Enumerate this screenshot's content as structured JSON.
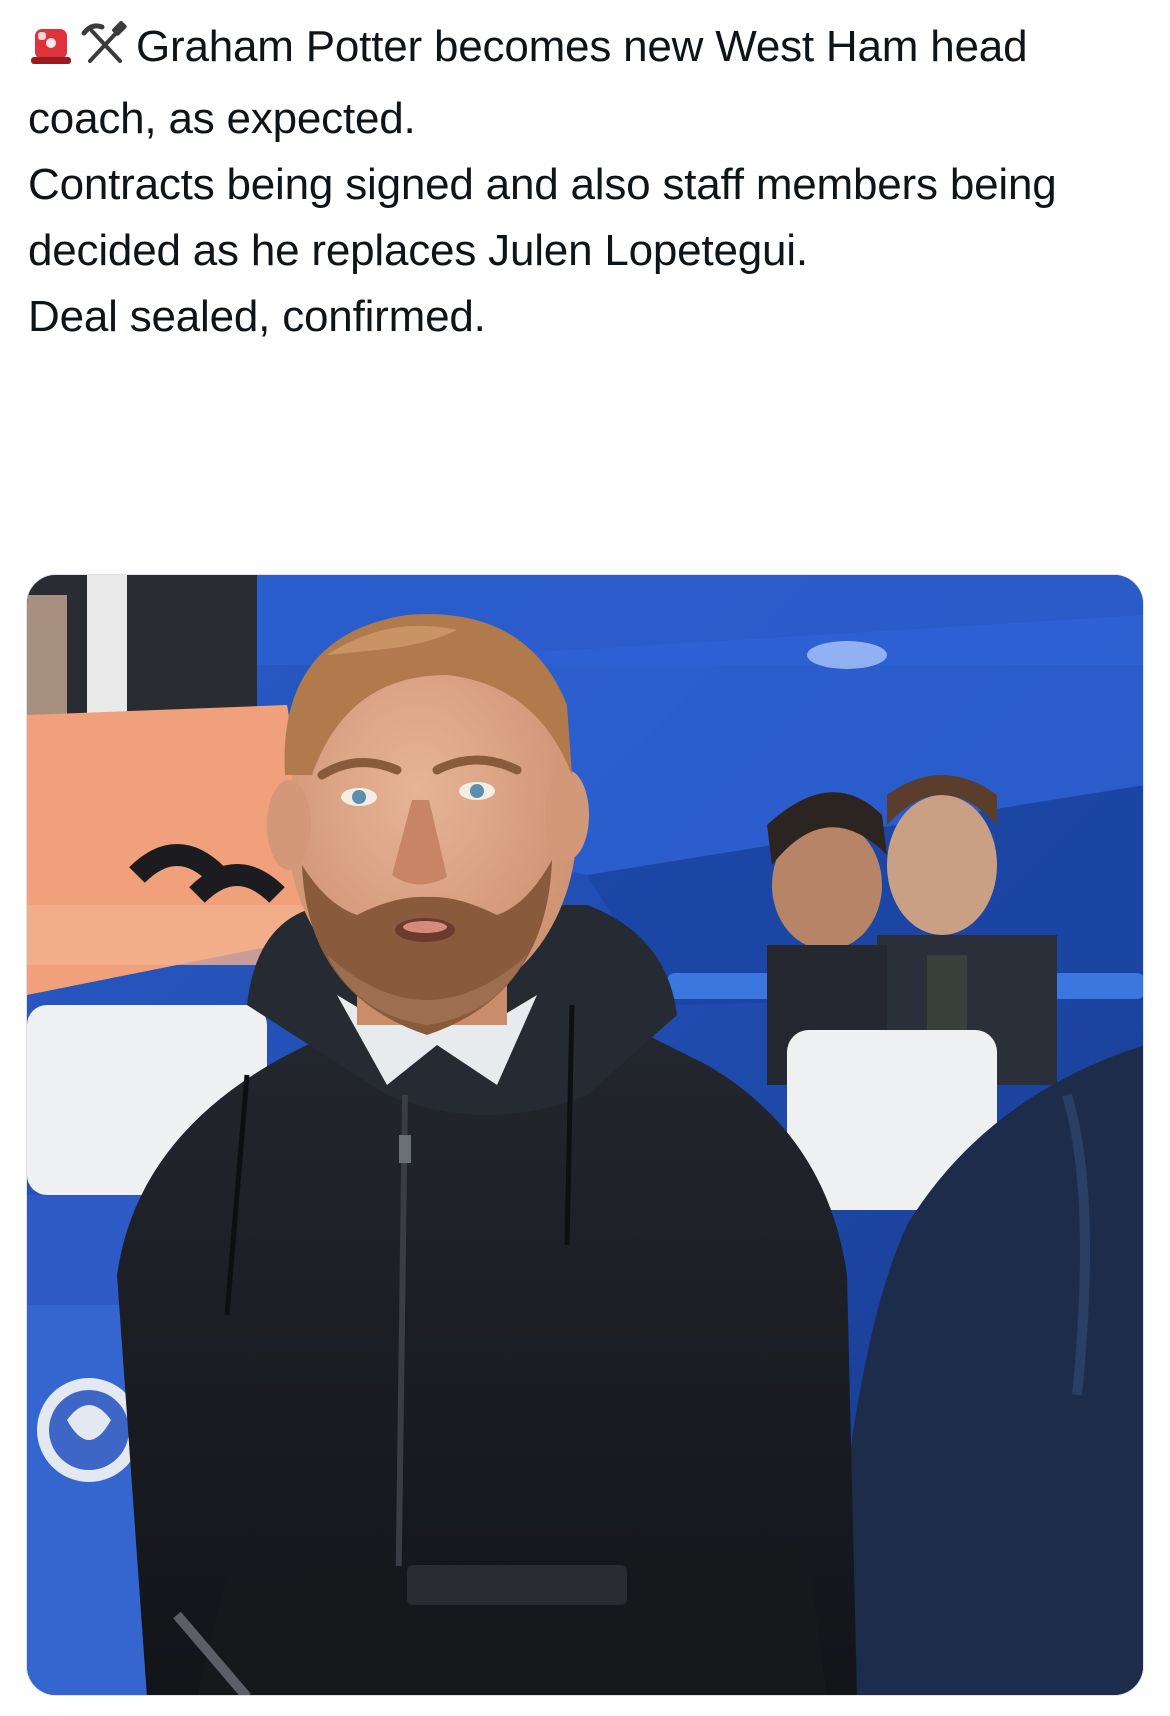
{
  "tweet": {
    "emojis": [
      "rotating-light-icon",
      "hammer-and-pick-icon"
    ],
    "line1": "Graham Potter becomes new West Ham head coach, as expected.",
    "line2": "Contracts being signed and also staff members being decided as he replaces Julen Lopetegui.",
    "line3": "Deal sealed, confirmed."
  },
  "media": {
    "type": "photo",
    "colors": {
      "stadium_blue": "#1f4fb8",
      "seat_white": "#eef0f2",
      "coat_black": "#1b1d24",
      "skin": "#d9a384",
      "beard": "#8a5a3c",
      "banner_peach": "#f0a07a"
    }
  }
}
